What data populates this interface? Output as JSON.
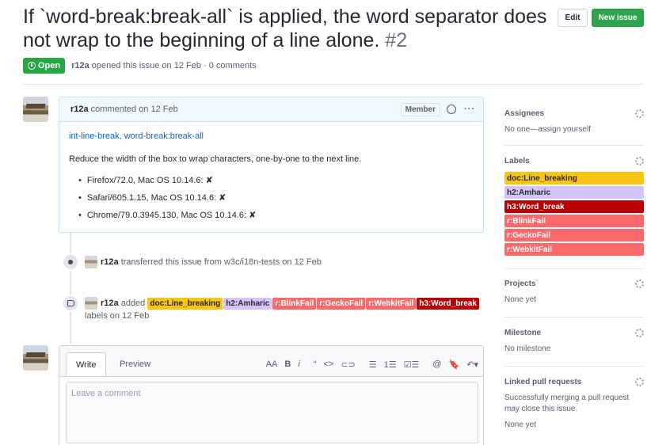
{
  "issue": {
    "title": "If `word-break:break-all` is applied, the word separator does not wrap to the beginning of a line alone.",
    "number": "#2",
    "state": "Open",
    "author": "r12a",
    "opened_text": "opened this issue on 12 Feb · 0 comments"
  },
  "header": {
    "edit_label": "Edit",
    "new_issue_label": "New issue"
  },
  "comment": {
    "author": "r12a",
    "action": "commented on 12 Feb",
    "role_badge": "Member",
    "link_text": "int-line-break, word-break:break-all",
    "body": "Reduce the width of the box to wrap characters, one-by-one to the next line.",
    "results": [
      "Firefox/72.0, Mac OS 10.14.6: ✘",
      "Safari/605.1.15, Mac OS 10.14.6: ✘",
      "Chrome/79.0.3945.130, Mac OS 10.14.6: ✘"
    ]
  },
  "timeline": {
    "transfer": {
      "actor": "r12a",
      "text": "transferred this issue from w3c/i18n-tests on 12 Feb"
    },
    "labels_event": {
      "actor": "r12a",
      "verb": "added",
      "suffix": "labels on 12 Feb",
      "labels": [
        {
          "name": "doc:Line_breaking",
          "bg": "#f9c513",
          "fg": "#24292e"
        },
        {
          "name": "h2:Amharic",
          "bg": "#d4c5f9",
          "fg": "#24292e"
        },
        {
          "name": "r:BlinkFail",
          "bg": "#fb6a6a",
          "fg": "#ffffff"
        },
        {
          "name": "r:GeckoFail",
          "bg": "#fb6a6a",
          "fg": "#ffffff"
        },
        {
          "name": "r:WebkitFail",
          "bg": "#fb6a6a",
          "fg": "#ffffff"
        },
        {
          "name": "h3:Word_break",
          "bg": "#b60205",
          "fg": "#ffffff"
        }
      ]
    }
  },
  "editor": {
    "tab_write": "Write",
    "tab_preview": "Preview",
    "placeholder": "Leave a comment",
    "toolbar": [
      "AA",
      "B",
      "i",
      "“",
      "<>",
      "⊂⊃",
      "☰",
      "1☰",
      "☑☰",
      "@",
      "🔖",
      "↶▾"
    ]
  },
  "sidebar": {
    "assignees": {
      "title": "Assignees",
      "text": "No one—assign yourself"
    },
    "labels": {
      "title": "Labels",
      "items": [
        {
          "name": "doc:Line_breaking",
          "bg": "#f9c513",
          "fg": "#24292e"
        },
        {
          "name": "h2:Amharic",
          "bg": "#d4c5f9",
          "fg": "#24292e"
        },
        {
          "name": "h3:Word_break",
          "bg": "#b60205",
          "fg": "#ffffff"
        },
        {
          "name": "r:BlinkFail",
          "bg": "#fb6a6a",
          "fg": "#ffffff"
        },
        {
          "name": "r:GeckoFail",
          "bg": "#fb6a6a",
          "fg": "#ffffff"
        },
        {
          "name": "r:WebkitFail",
          "bg": "#fb6a6a",
          "fg": "#ffffff"
        }
      ]
    },
    "projects": {
      "title": "Projects",
      "text": "None yet"
    },
    "milestone": {
      "title": "Milestone",
      "text": "No milestone"
    },
    "linked": {
      "title": "Linked pull requests",
      "text": "Successfully merging a pull request may close this issue.",
      "text2": "None yet"
    }
  },
  "colors": {
    "open_green": "#28a745",
    "link_blue": "#0366d6",
    "comment_border": "#c8e1ff"
  }
}
